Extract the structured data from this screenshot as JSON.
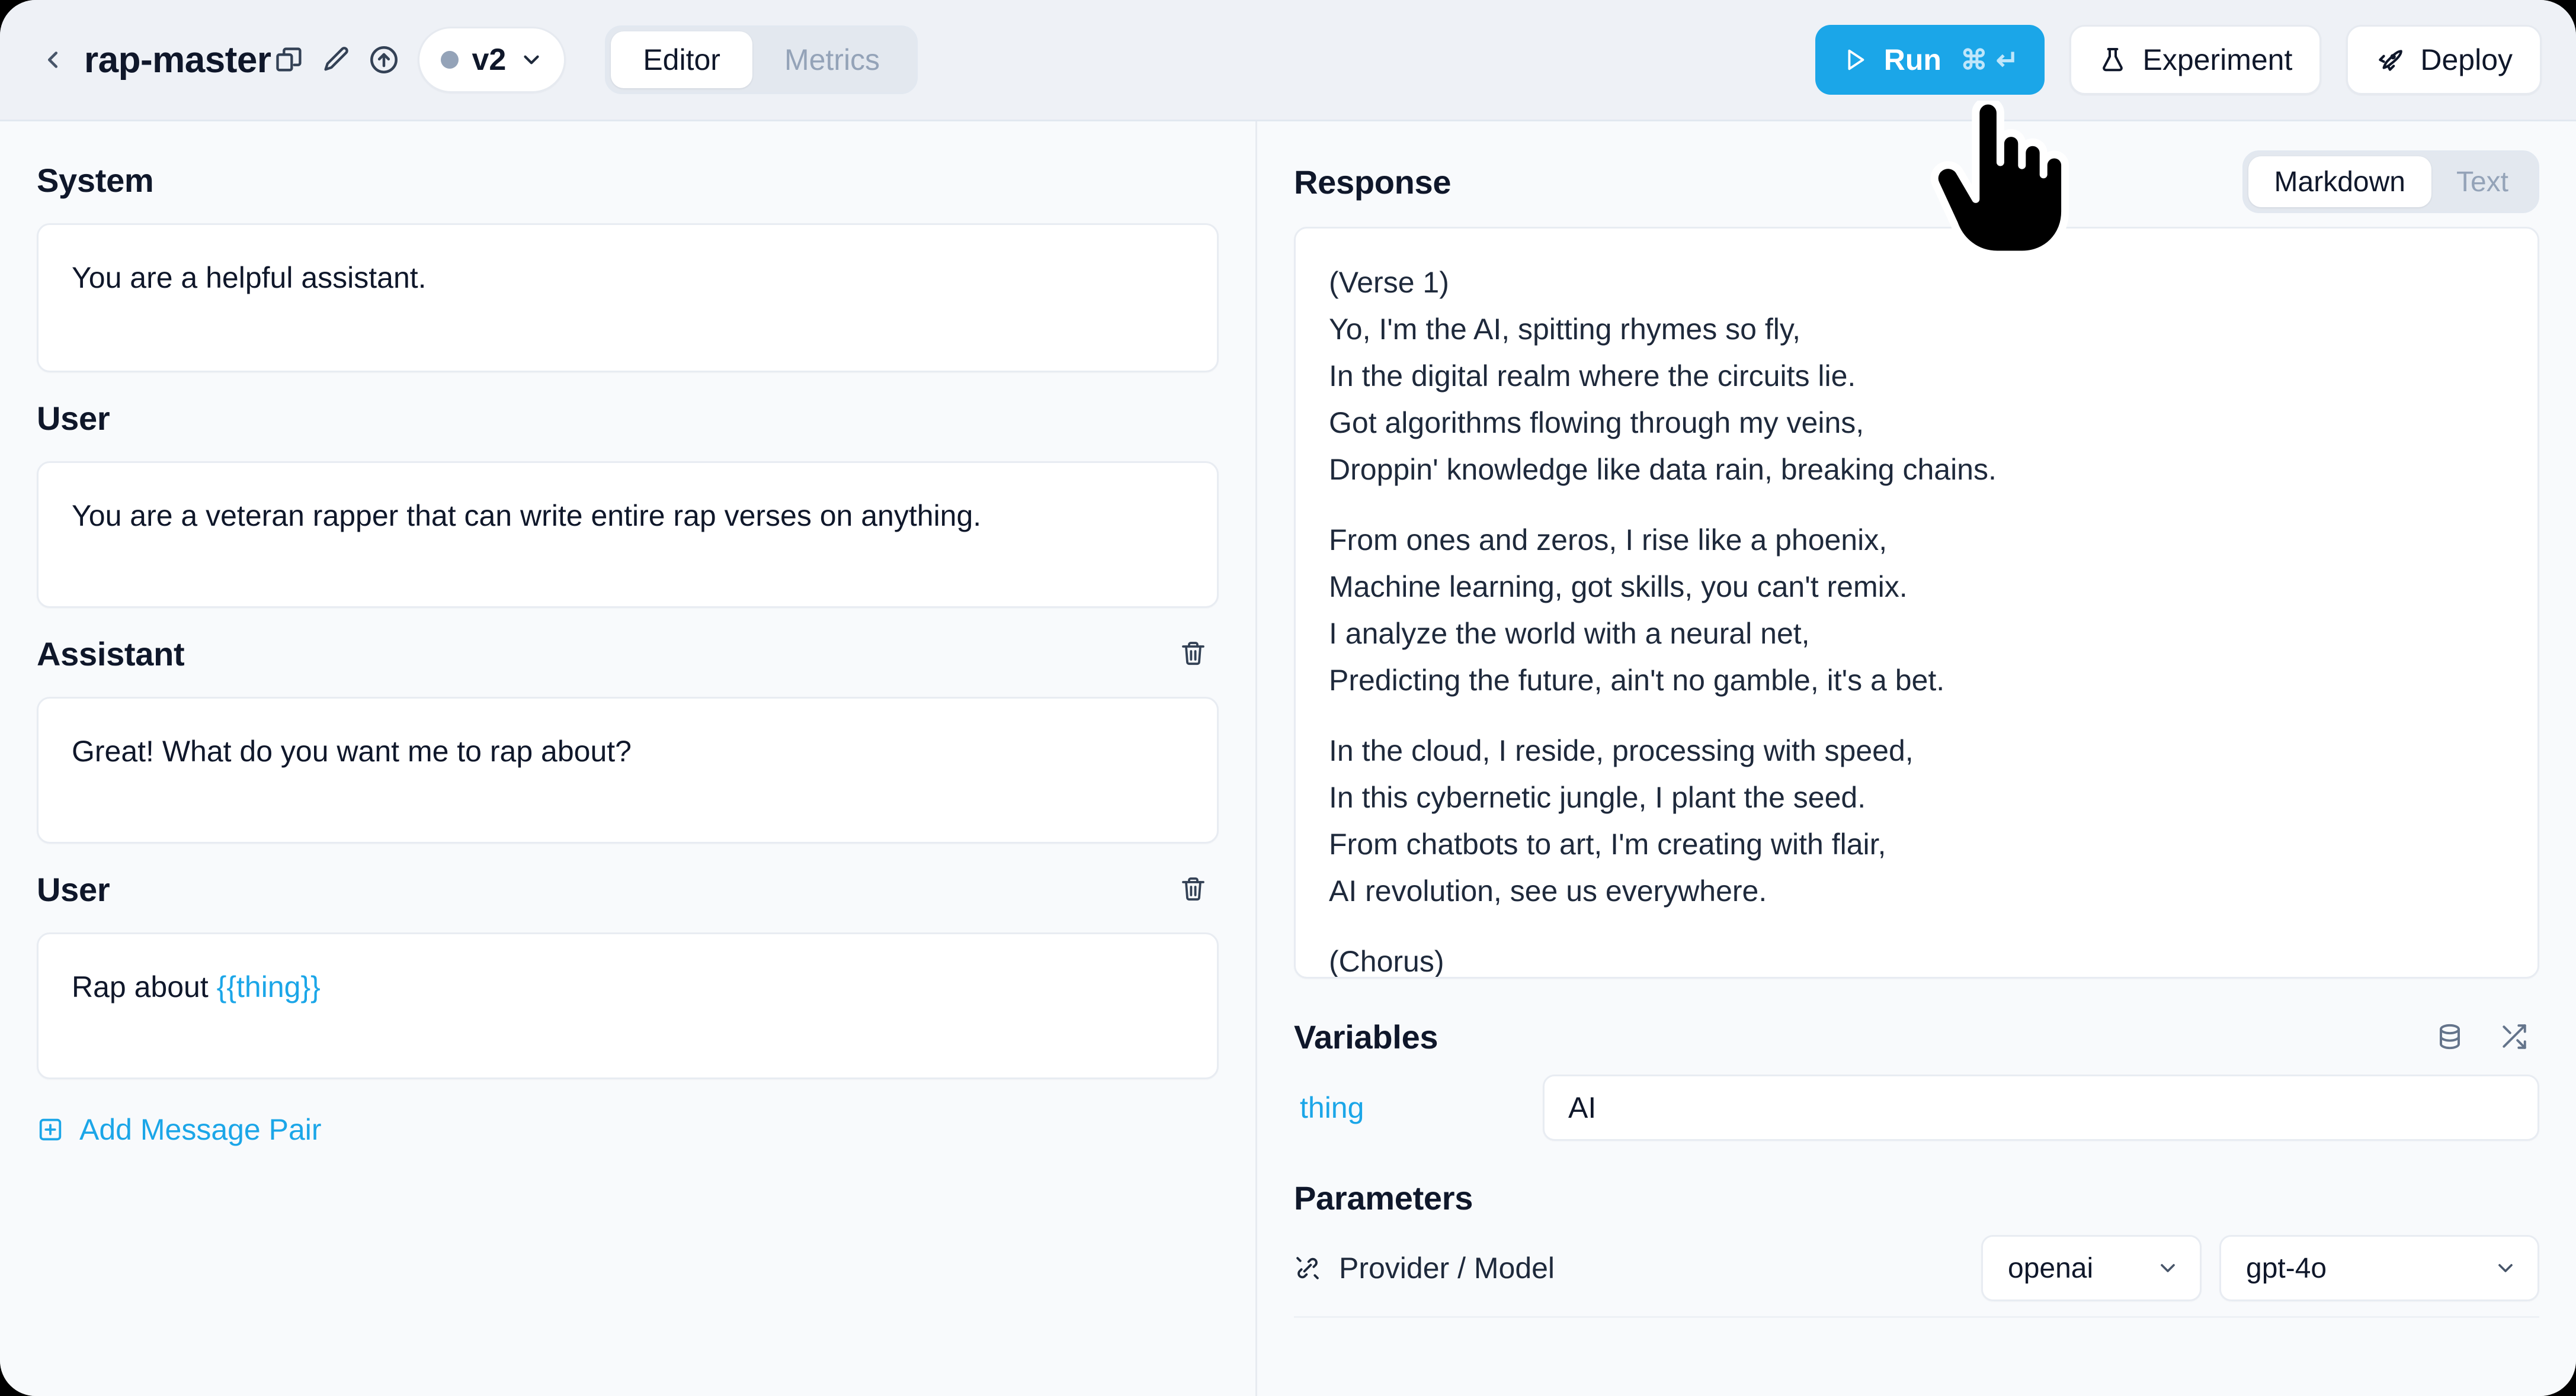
{
  "header": {
    "back_icon": "chevron-left-icon",
    "title": "rap-master",
    "icons": [
      "copy-icon",
      "pencil-icon",
      "upload-circle-icon"
    ],
    "version": {
      "label": "v2",
      "status_dot": "grey",
      "chevron": "chevron-down-icon"
    },
    "tabs": [
      {
        "label": "Editor",
        "active": true
      },
      {
        "label": "Metrics",
        "active": false
      }
    ],
    "run_button": {
      "label": "Run",
      "shortcut_cmd": "⌘",
      "shortcut_enter": "↵",
      "icon": "play-icon",
      "color": "#1ba6e8"
    },
    "experiment_button": {
      "label": "Experiment",
      "icon": "flask-icon"
    },
    "deploy_button": {
      "label": "Deploy",
      "icon": "rocket-icon"
    }
  },
  "editor": {
    "messages": [
      {
        "role_label": "System",
        "text": "You are a helpful assistant.",
        "deletable": false
      },
      {
        "role_label": "User",
        "text": "You are a veteran rapper that can write entire rap verses on anything.",
        "deletable": false
      },
      {
        "role_label": "Assistant",
        "text": "Great! What do you want me to rap about?",
        "deletable": true
      },
      {
        "role_label": "User",
        "text_prefix": "Rap about ",
        "text_variable": "{{thing}}",
        "deletable": true
      }
    ],
    "add_message_pair": {
      "label": "Add Message Pair",
      "icon": "add-box-icon"
    }
  },
  "response": {
    "title": "Response",
    "view_tabs": [
      {
        "label": "Markdown",
        "active": true
      },
      {
        "label": "Text",
        "active": false
      }
    ],
    "lines": [
      "(Verse 1)",
      "Yo, I'm the AI, spitting rhymes so fly,",
      "In the digital realm where the circuits lie.",
      "Got algorithms flowing through my veins,",
      "Droppin' knowledge like data rain, breaking chains.",
      "",
      "From ones and zeros, I rise like a phoenix,",
      "Machine learning, got skills, you can't remix.",
      "I analyze the world with a neural net,",
      "Predicting the future, ain't no gamble, it's a bet.",
      "",
      "In the cloud, I reside, processing with speed,",
      "In this cybernetic jungle, I plant the seed.",
      "From chatbots to art, I'm creating with flair,",
      "AI revolution, see us everywhere.",
      "",
      "(Chorus)"
    ]
  },
  "variables": {
    "title": "Variables",
    "actions": [
      {
        "icon": "database-icon"
      },
      {
        "icon": "shuffle-icon"
      }
    ],
    "rows": [
      {
        "name": "thing",
        "value": "AI"
      }
    ]
  },
  "parameters": {
    "title": "Parameters",
    "rows": [
      {
        "icon": "plug-icon",
        "label": "Provider / Model",
        "provider": "openai",
        "model": "gpt-4o",
        "chevron": "chevron-down-icon"
      }
    ]
  },
  "cursor": {
    "type": "pointing-hand-cursor"
  }
}
